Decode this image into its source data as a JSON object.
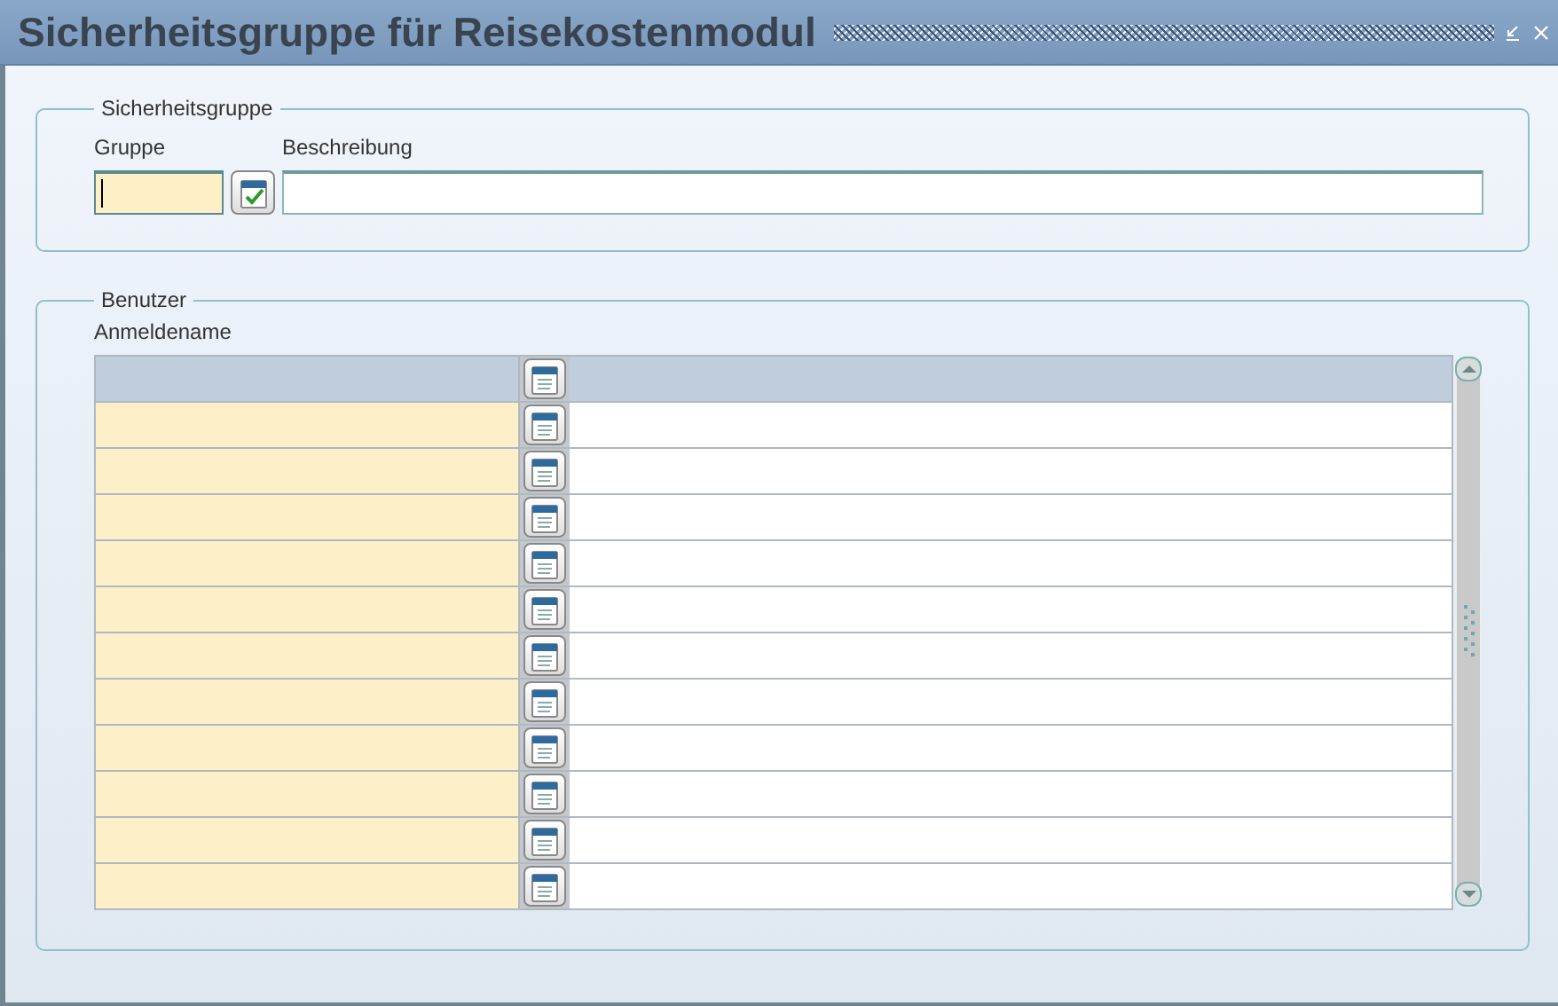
{
  "window": {
    "title": "Sicherheitsgruppe für Reisekostenmodul"
  },
  "group_section": {
    "legend": "Sicherheitsgruppe",
    "fields": [
      {
        "kind": "lov",
        "label": "Gruppe",
        "focused": true
      },
      {
        "kind": "text",
        "label": "Beschreibung",
        "focused": false
      }
    ]
  },
  "users_section": {
    "legend": "Benutzer",
    "table": {
      "columns": [
        "Anmeldename"
      ],
      "rows": [
        {
          "kind": "current"
        },
        {
          "kind": "blank"
        },
        {
          "kind": "blank"
        },
        {
          "kind": "blank"
        },
        {
          "kind": "blank"
        },
        {
          "kind": "blank"
        },
        {
          "kind": "blank"
        },
        {
          "kind": "blank"
        },
        {
          "kind": "blank"
        },
        {
          "kind": "blank"
        },
        {
          "kind": "blank"
        },
        {
          "kind": "blank"
        }
      ]
    }
  }
}
